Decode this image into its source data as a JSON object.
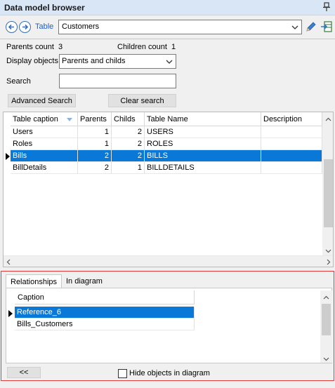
{
  "window": {
    "title": "Data model browser",
    "pin_icon": "pin-icon"
  },
  "toolbar": {
    "back_icon": "arrow-left-circle-icon",
    "forward_icon": "arrow-right-circle-icon",
    "table_link": "Table",
    "table_value": "Customers",
    "edit_icon": "pencil-icon",
    "goto_icon": "goto-table-icon"
  },
  "info": {
    "parents_label": "Parents count",
    "parents_value": "3",
    "children_label": "Children count",
    "children_value": "1"
  },
  "filters": {
    "display_label": "Display objects",
    "display_value": "Parents and childs",
    "search_label": "Search",
    "search_value": "",
    "advanced_search": "Advanced Search",
    "clear_search": "Clear search"
  },
  "grid": {
    "columns": [
      "Table caption",
      "Parents",
      "Childs",
      "Table Name",
      "Description"
    ],
    "rows": [
      {
        "caption": "Users",
        "parents": "1",
        "childs": "2",
        "name": "USERS",
        "description": ""
      },
      {
        "caption": "Roles",
        "parents": "1",
        "childs": "2",
        "name": "ROLES",
        "description": ""
      },
      {
        "caption": "Bills",
        "parents": "2",
        "childs": "2",
        "name": "BILLS",
        "description": ""
      },
      {
        "caption": "BillDetails",
        "parents": "2",
        "childs": "1",
        "name": "BILLDETAILS",
        "description": ""
      }
    ],
    "selected_row": 2
  },
  "lower": {
    "tabs": [
      "Relationships",
      "In diagram"
    ],
    "active_tab": "Relationships",
    "rel_column": "Caption",
    "rel_rows": [
      "Reference_6",
      "Bills_Customers"
    ],
    "selected_rel": 0,
    "collapse_label": "<<",
    "hide_label": "Hide objects in diagram",
    "hide_checked": false
  },
  "colors": {
    "selection": "#0a78d7",
    "highlight_border": "#e03c3c",
    "link": "#1f5fbf"
  }
}
